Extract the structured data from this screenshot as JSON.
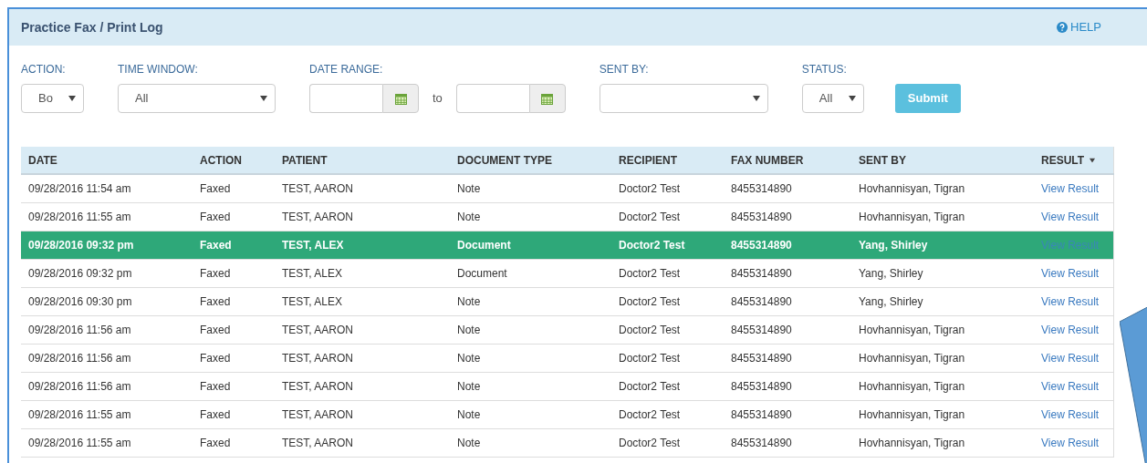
{
  "panel": {
    "title": "Practice Fax / Print Log",
    "help": "HELP"
  },
  "filters": [
    {
      "kind": "select",
      "label": "ACTION:",
      "value": "Bo"
    },
    {
      "kind": "select",
      "label": "TIME WINDOW:",
      "value": "All"
    },
    {
      "kind": "daterange",
      "label": "DATE RANGE:",
      "separator": "to"
    },
    {
      "kind": "select",
      "label": "SENT BY:"
    },
    {
      "kind": "select",
      "label": "STATUS:",
      "value": "All"
    }
  ],
  "submit": "Submit",
  "table": {
    "columns": [
      {
        "label": "DATE",
        "sorted": false
      },
      {
        "label": "ACTION",
        "sorted": false
      },
      {
        "label": "PATIENT",
        "sorted": false
      },
      {
        "label": "DOCUMENT TYPE",
        "sorted": false
      },
      {
        "label": "RECIPIENT",
        "sorted": false
      },
      {
        "label": "FAX NUMBER",
        "sorted": false
      },
      {
        "label": "SENT BY",
        "sorted": false
      },
      {
        "label": "RESULT",
        "sorted": true
      }
    ],
    "rows": [
      {
        "selected": false,
        "cells": [
          "09/28/2016 11:54 am",
          "Faxed",
          "TEST, AARON",
          "Note",
          "Doctor2 Test",
          "8455314890",
          "Hovhannisyan, Tigran",
          "View Result"
        ]
      },
      {
        "selected": false,
        "cells": [
          "09/28/2016 11:55 am",
          "Faxed",
          "TEST, AARON",
          "Note",
          "Doctor2 Test",
          "8455314890",
          "Hovhannisyan, Tigran",
          "View Result"
        ]
      },
      {
        "selected": true,
        "cells": [
          "09/28/2016 09:32 pm",
          "Faxed",
          "TEST, ALEX",
          "Document",
          "Doctor2 Test",
          "8455314890",
          "Yang, Shirley",
          "View Result"
        ]
      },
      {
        "selected": false,
        "cells": [
          "09/28/2016 09:32 pm",
          "Faxed",
          "TEST, ALEX",
          "Document",
          "Doctor2 Test",
          "8455314890",
          "Yang, Shirley",
          "View Result"
        ]
      },
      {
        "selected": false,
        "cells": [
          "09/28/2016 09:30 pm",
          "Faxed",
          "TEST, ALEX",
          "Note",
          "Doctor2 Test",
          "8455314890",
          "Yang, Shirley",
          "View Result"
        ]
      },
      {
        "selected": false,
        "cells": [
          "09/28/2016 11:56 am",
          "Faxed",
          "TEST, AARON",
          "Note",
          "Doctor2 Test",
          "8455314890",
          "Hovhannisyan, Tigran",
          "View Result"
        ]
      },
      {
        "selected": false,
        "cells": [
          "09/28/2016 11:56 am",
          "Faxed",
          "TEST, AARON",
          "Note",
          "Doctor2 Test",
          "8455314890",
          "Hovhannisyan, Tigran",
          "View Result"
        ]
      },
      {
        "selected": false,
        "cells": [
          "09/28/2016 11:56 am",
          "Faxed",
          "TEST, AARON",
          "Note",
          "Doctor2 Test",
          "8455314890",
          "Hovhannisyan, Tigran",
          "View Result"
        ]
      },
      {
        "selected": false,
        "cells": [
          "09/28/2016 11:55 am",
          "Faxed",
          "TEST, AARON",
          "Note",
          "Doctor2 Test",
          "8455314890",
          "Hovhannisyan, Tigran",
          "View Result"
        ]
      },
      {
        "selected": false,
        "cells": [
          "09/28/2016 11:55 am",
          "Faxed",
          "TEST, AARON",
          "Note",
          "Doctor2 Test",
          "8455314890",
          "Hovhannisyan, Tigran",
          "View Result"
        ]
      }
    ]
  }
}
